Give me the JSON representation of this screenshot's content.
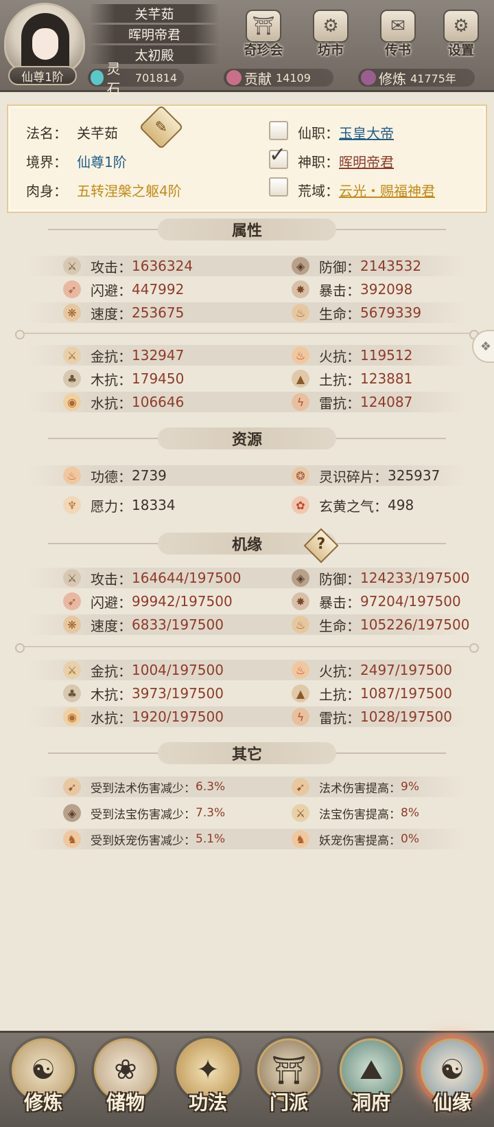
{
  "header": {
    "rank_badge": "仙尊1阶",
    "name_lines": [
      "关芊茹",
      "晖明帝君",
      "太初殿"
    ],
    "buttons": [
      {
        "label": "奇珍会",
        "icon": "treasure-pavilion-icon",
        "glyph": "⛩"
      },
      {
        "label": "坊市",
        "icon": "market-icon",
        "glyph": "⚙"
      },
      {
        "label": "传书",
        "icon": "scroll-letter-icon",
        "glyph": "✉"
      },
      {
        "label": "设置",
        "icon": "gear-icon",
        "glyph": "⚙"
      }
    ],
    "resources": [
      {
        "label": "灵石",
        "value": "701814",
        "icon": "spirit-stone-icon",
        "color": "#5cc6c8"
      },
      {
        "label": "贡献",
        "value": "14109",
        "icon": "contribution-icon",
        "color": "#c96f8a"
      },
      {
        "label": "修炼",
        "value": "41775年",
        "icon": "cultivation-icon",
        "color": "#9a5f8e"
      }
    ]
  },
  "info": {
    "fa_name_label": "法名：",
    "fa_name": "关芊茹",
    "realm_label": "境界：",
    "realm": "仙尊1阶",
    "body_label": "肉身：",
    "body": "五转涅槃之躯4阶",
    "xian_label": "仙职：",
    "xian": "玉皇大帝",
    "shen_label": "神职：",
    "shen": "晖明帝君",
    "huang_label": "荒域：",
    "huang": "云光・赐福神君",
    "checks": [
      false,
      true,
      false
    ]
  },
  "sections": {
    "attributes": "属性",
    "resources": "资源",
    "fortune": "机缘",
    "other": "其它"
  },
  "attributes": [
    {
      "l_label": "攻击：",
      "l_val": "1636324",
      "r_label": "防御：",
      "r_val": "2143532"
    },
    {
      "l_label": "闪避：",
      "l_val": "447992",
      "r_label": "暴击：",
      "r_val": "392098"
    },
    {
      "l_label": "速度：",
      "l_val": "253675",
      "r_label": "生命：",
      "r_val": "5679339"
    },
    {
      "l_label": "金抗：",
      "l_val": "132947",
      "r_label": "火抗：",
      "r_val": "119512"
    },
    {
      "l_label": "木抗：",
      "l_val": "179450",
      "r_label": "土抗：",
      "r_val": "123881"
    },
    {
      "l_label": "水抗：",
      "l_val": "106646",
      "r_label": "雷抗：",
      "r_val": "124087"
    }
  ],
  "resources": [
    {
      "l_label": "功德：",
      "l_val": "2739",
      "r_label": "灵识碎片：",
      "r_val": "325937"
    },
    {
      "l_label": "愿力：",
      "l_val": "18334",
      "r_label": "玄黄之气：",
      "r_val": "498"
    }
  ],
  "fortune": [
    {
      "l_label": "攻击：",
      "l_val": "164644/197500",
      "r_label": "防御：",
      "r_val": "124233/197500"
    },
    {
      "l_label": "闪避：",
      "l_val": "99942/197500",
      "r_label": "暴击：",
      "r_val": "97204/197500"
    },
    {
      "l_label": "速度：",
      "l_val": "6833/197500",
      "r_label": "生命：",
      "r_val": "105226/197500"
    },
    {
      "l_label": "金抗：",
      "l_val": "1004/197500",
      "r_label": "火抗：",
      "r_val": "2497/197500"
    },
    {
      "l_label": "木抗：",
      "l_val": "3973/197500",
      "r_label": "土抗：",
      "r_val": "1087/197500"
    },
    {
      "l_label": "水抗：",
      "l_val": "1920/197500",
      "r_label": "雷抗：",
      "r_val": "1028/197500"
    }
  ],
  "other": [
    {
      "l_label": "受到法术伤害减少：",
      "l_val": "6.3%",
      "r_label": "法术伤害提高：",
      "r_val": "9%"
    },
    {
      "l_label": "受到法宝伤害减少：",
      "l_val": "7.3%",
      "r_label": "法宝伤害提高：",
      "r_val": "8%"
    },
    {
      "l_label": "受到妖宠伤害减少：",
      "l_val": "5.1%",
      "r_label": "妖宠伤害提高：",
      "r_val": "0%"
    }
  ],
  "nav": [
    {
      "label": "修炼",
      "icon": "cultivate-icon",
      "glyph": "☯",
      "color": "#d9c29a"
    },
    {
      "label": "储物",
      "icon": "storage-bag-icon",
      "glyph": "❀",
      "color": "#e3d2b8"
    },
    {
      "label": "功法",
      "icon": "technique-book-icon",
      "glyph": "✦",
      "color": "#e0c68f"
    },
    {
      "label": "门派",
      "icon": "sect-gate-icon",
      "glyph": "⛩",
      "color": "#c7b48c"
    },
    {
      "label": "洞府",
      "icon": "cave-dwelling-icon",
      "glyph": "⛰",
      "color": "#8fb2a0"
    },
    {
      "label": "仙缘",
      "icon": "immortal-fate-icon",
      "glyph": "☯",
      "color": "#8aa8b8"
    }
  ],
  "help_glyph": "?"
}
